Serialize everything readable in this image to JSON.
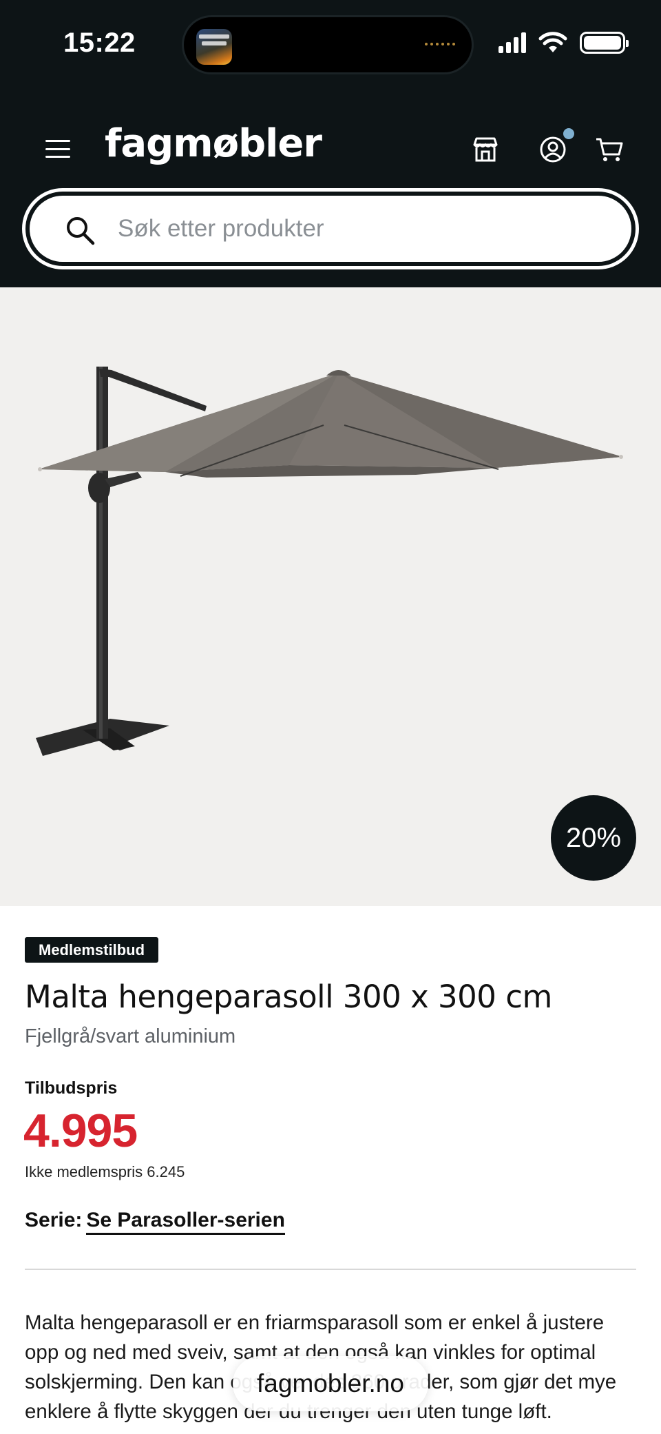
{
  "status_bar": {
    "time": "15:22",
    "icons": [
      "signal-icon",
      "wifi-icon",
      "battery-icon"
    ]
  },
  "header": {
    "logo": "fagmøbler",
    "icons": [
      "menu-icon",
      "store-icon",
      "account-icon",
      "cart-icon"
    ],
    "notification_dot_color": "#7fb0d0"
  },
  "search": {
    "placeholder": "Søk etter produkter"
  },
  "product": {
    "discount_badge": "20%",
    "member_badge": "Medlemstilbud",
    "title": "Malta hengeparasoll 300 x 300 cm",
    "subtitle": "Fjellgrå/svart aluminium",
    "offer_label": "Tilbudspris",
    "price": "4.995",
    "price_color": "#d7242f",
    "non_member_price": "Ikke medlemspris 6.245",
    "series_label": "Serie:",
    "series_link": "Se Parasoller-serien",
    "description": "Malta hengeparasoll er en friarmsparasoll som er enkel å justere opp og ned med sveiv, samt at den også kan vinkles for optimal solskjerming. Den kan også vendes 360 grader, som gjør det mye enklere å flytte skyggen der du trenger den uten tunge løft."
  },
  "browser": {
    "url": "fagmobler.no"
  }
}
